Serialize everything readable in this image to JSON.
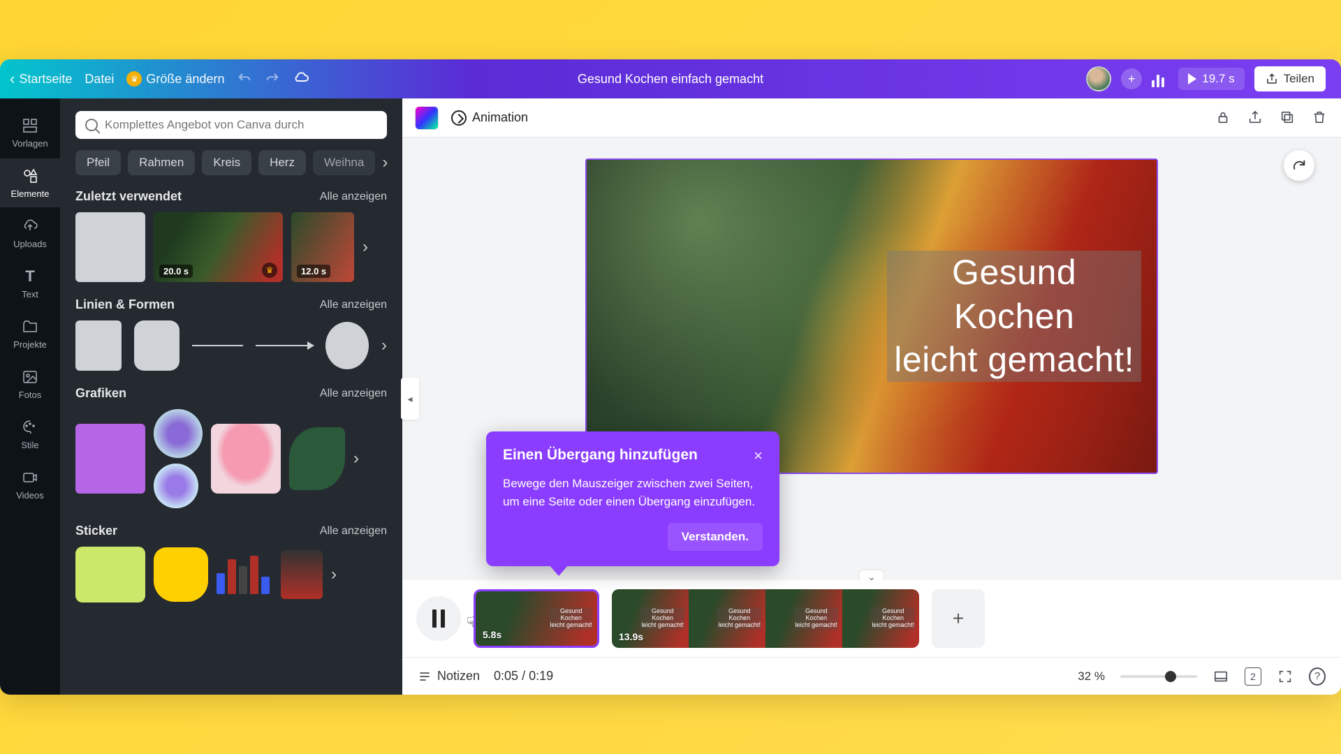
{
  "header": {
    "home": "Startseite",
    "file": "Datei",
    "resize": "Größe ändern",
    "doc_title": "Gesund Kochen einfach gemacht",
    "duration": "19.7 s",
    "share": "Teilen"
  },
  "navrail": {
    "templates": "Vorlagen",
    "elements": "Elemente",
    "uploads": "Uploads",
    "text": "Text",
    "styles": "Stile",
    "projects": "Projekte",
    "photos": "Fotos",
    "videos": "Videos"
  },
  "panel": {
    "search_placeholder": "Komplettes Angebot von Canva durch",
    "chips": [
      "Pfeil",
      "Rahmen",
      "Kreis",
      "Herz",
      "Weihna"
    ],
    "see_all": "Alle anzeigen",
    "recent": {
      "title": "Zuletzt verwendet",
      "dur1": "20.0 s",
      "dur2": "12.0 s"
    },
    "lines": {
      "title": "Linien & Formen"
    },
    "graphics": {
      "title": "Grafiken"
    },
    "stickers": {
      "title": "Sticker"
    }
  },
  "context_toolbar": {
    "animation": "Animation"
  },
  "canvas_text": {
    "l1": "Gesund",
    "l2": "Kochen",
    "l3": "leicht gemacht!"
  },
  "tooltip": {
    "title": "Einen Übergang hinzufügen",
    "body": "Bewege den Mauszeiger zwischen zwei Seiten, um eine Seite oder einen Übergang einzufügen.",
    "ok": "Verstanden."
  },
  "timeline": {
    "clip1_dur": "5.8s",
    "clip2_dur": "13.9s",
    "mini_l1": "Gesund",
    "mini_l2": "Kochen",
    "mini_l3": "leicht gemacht!"
  },
  "bottom": {
    "notes": "Notizen",
    "time": "0:05 / 0:19",
    "zoom": "32 %",
    "page_num": "2"
  }
}
